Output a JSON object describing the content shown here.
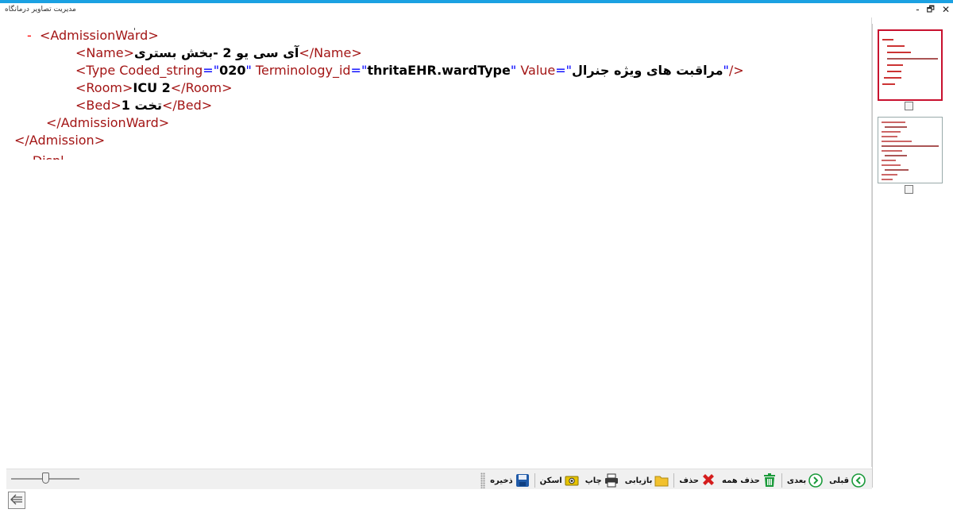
{
  "window": {
    "title": "مدیریت تصاویر درمانگاه",
    "controls": {
      "minimize": "-",
      "restore": "🗗",
      "close": "✕"
    }
  },
  "xml": {
    "lines": [
      {
        "minus": "-",
        "open": "<AdmissionWard>"
      },
      {
        "open": "<Name>",
        "text": "آی سی یو 2 -بخش بستری",
        "close": "</Name>"
      },
      {
        "open_start": "<Type ",
        "attr1": "Coded_string",
        "val1": "020",
        "attr2": "Terminology_id",
        "val2": "thritaEHR.wardType",
        "attr3": "Value",
        "val3": "مراقبت های ویژه جنرال",
        "end": "/>"
      },
      {
        "open": "<Room>",
        "text": "ICU 2",
        "close": "</Room>"
      },
      {
        "open": "<Bed>",
        "text": "تخت 1",
        "close": "</Bed>"
      },
      {
        "close": "</AdmissionWard>"
      },
      {
        "close": "</Admission>"
      },
      {
        "partial": "- Displ"
      }
    ]
  },
  "thumbnails": [
    {
      "selected": true,
      "checked": false
    },
    {
      "selected": false,
      "checked": false
    }
  ],
  "toolbar": {
    "save": "ذخیره",
    "scan": "اسکن",
    "print": "چاپ",
    "retrieve": "بازیابی",
    "delete": "حذف",
    "delete_all": "حذف همه",
    "next": "بعدی",
    "prev": "قبلی"
  },
  "zoom_slider": {
    "level": 0.5
  },
  "colors": {
    "accent": "#1ba1e2",
    "selected_thumb": "#c8102e",
    "xml_bracket": "#0000ff",
    "xml_tag": "#a31515",
    "save_icon": "#1f5aa8",
    "scan_icon": "#e7c400",
    "print_icon": "#3a3a3a",
    "folder_icon": "#f2c12e",
    "delete_icon": "#d41c1c",
    "delete_all_icon": "#1a9a3a",
    "nav_icon": "#1a9a3a"
  }
}
